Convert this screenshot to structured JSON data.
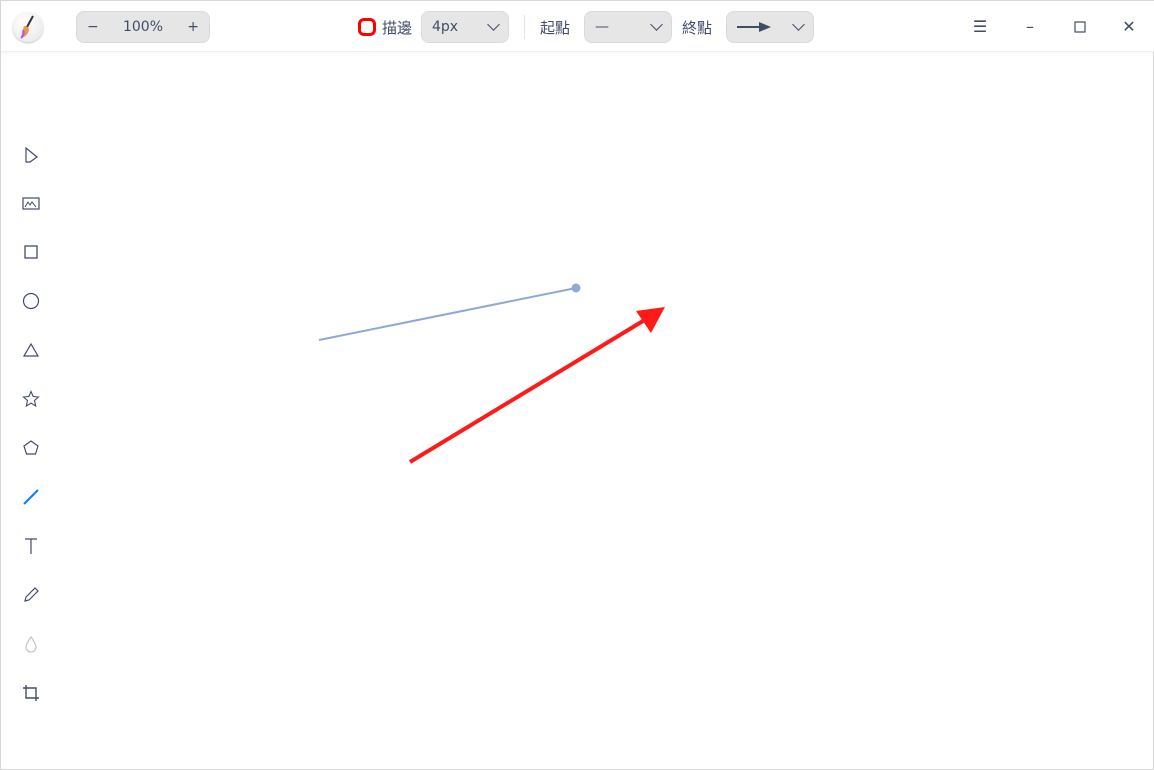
{
  "toolbar": {
    "zoom_out": "−",
    "zoom_level": "100%",
    "zoom_in": "+",
    "stroke_label": "描邊",
    "stroke_width": "4px",
    "start_label": "起點",
    "start_value": "—",
    "end_label": "終點"
  },
  "colors": {
    "stroke": "#ff0000",
    "accent": "#0081ff",
    "line": "#8fa9d6"
  },
  "tools": [
    "select",
    "image",
    "rectangle",
    "ellipse",
    "triangle",
    "star",
    "polygon",
    "line",
    "text",
    "pencil",
    "blur",
    "crop"
  ]
}
